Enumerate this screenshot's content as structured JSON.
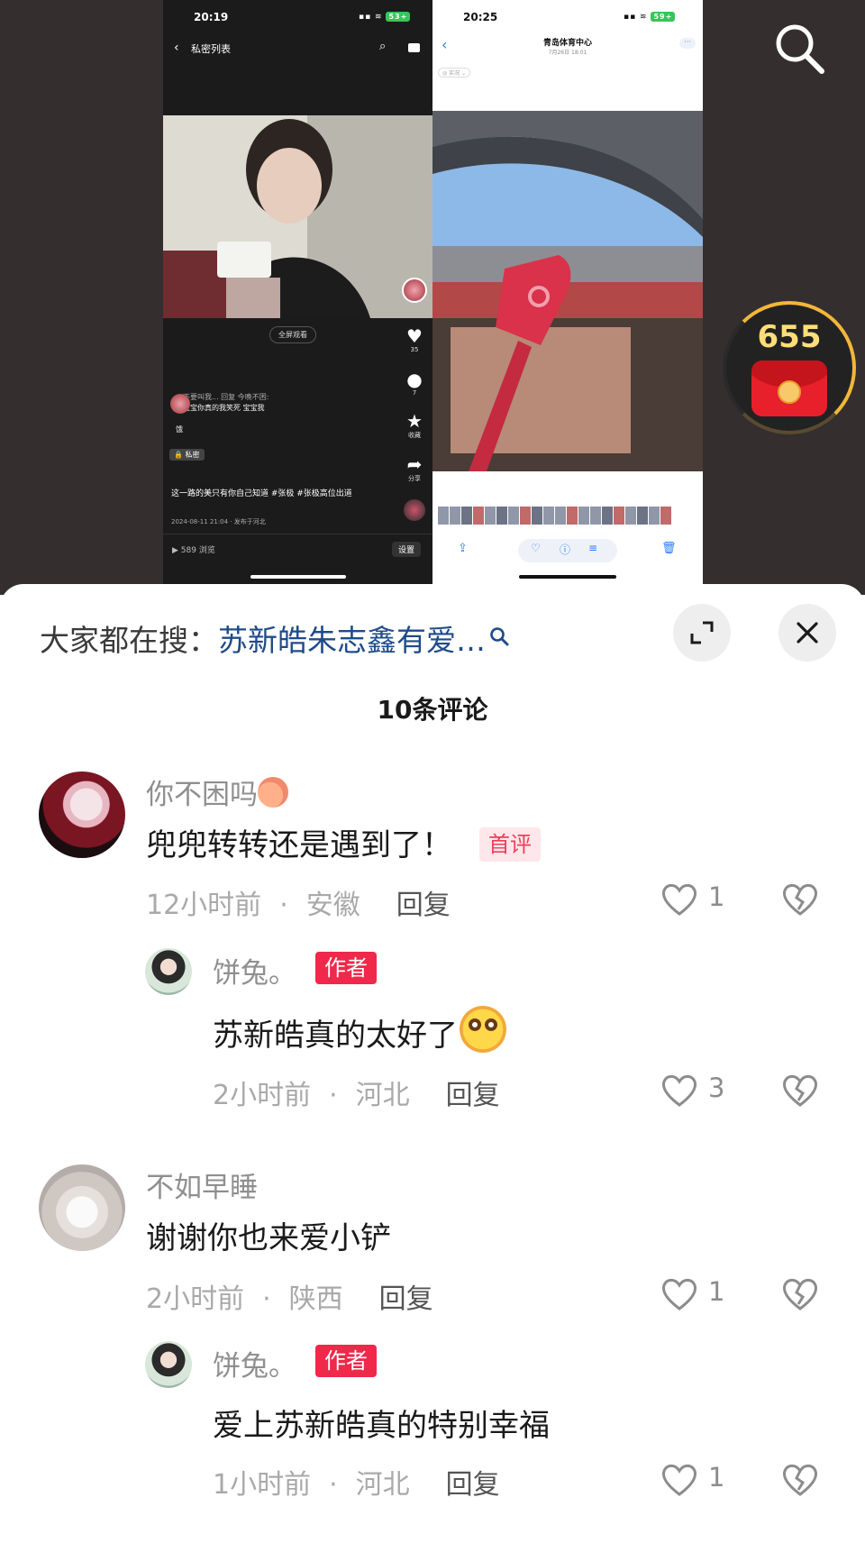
{
  "screenshot_left": {
    "status_time": "20:19",
    "battery": "53+",
    "header_title": "私密列表",
    "fullscreen_label": "全屏观看",
    "likes": "35",
    "comments": "7",
    "favorite_label": "收藏",
    "share_label": "分享",
    "comment_user": "不要叫我... 回复 今晚不困:",
    "comment_text": "宝宝你真的我笑死 宝宝我",
    "comment_tail": "饿",
    "private_label": "私密",
    "caption": "这一路的美只有你自己知道 #张极 #张极高位出道",
    "date_line": "2024-08-11 21:04 · 发布于河北",
    "views": "589 浏览",
    "settings_label": "设置"
  },
  "screenshot_right": {
    "status_time": "20:25",
    "battery": "59+",
    "title": "青岛体育中心",
    "date": "7月26日 18:01",
    "tag": "实况",
    "more": "···"
  },
  "reward": {
    "count": "655"
  },
  "panel": {
    "hot_prefix": "大家都在搜：",
    "hot_query": "苏新皓朱志鑫有爱…",
    "comment_count": "10条评论"
  },
  "comments": [
    {
      "user": "你不困吗",
      "text": "兜兜转转还是遇到了！",
      "badge": "首评",
      "time": "12小时前",
      "region": "安徽",
      "reply": "回复",
      "likes": "1",
      "replies": [
        {
          "user": "饼兔。",
          "badge": "作者",
          "text": "苏新皓真的太好了",
          "time": "2小时前",
          "region": "河北",
          "reply": "回复",
          "likes": "3"
        }
      ]
    },
    {
      "user": "不如早睡",
      "text": "谢谢你也来爱小铲",
      "time": "2小时前",
      "region": "陕西",
      "reply": "回复",
      "likes": "1",
      "replies": [
        {
          "user": "饼兔。",
          "badge": "作者",
          "text": "爱上苏新皓真的特别幸福",
          "time": "1小时前",
          "region": "河北",
          "reply": "回复",
          "likes": "1"
        }
      ]
    }
  ],
  "icons": {
    "search": "search-icon",
    "expand": "expand-icon",
    "close": "close-icon",
    "like": "heart-icon",
    "dislike": "broken-heart-icon"
  },
  "colors": {
    "author_badge": "#f0284a",
    "first_badge_bg": "#fde7ea",
    "hot_query": "#1f4b89",
    "reward_ring": "#f2b63a"
  }
}
